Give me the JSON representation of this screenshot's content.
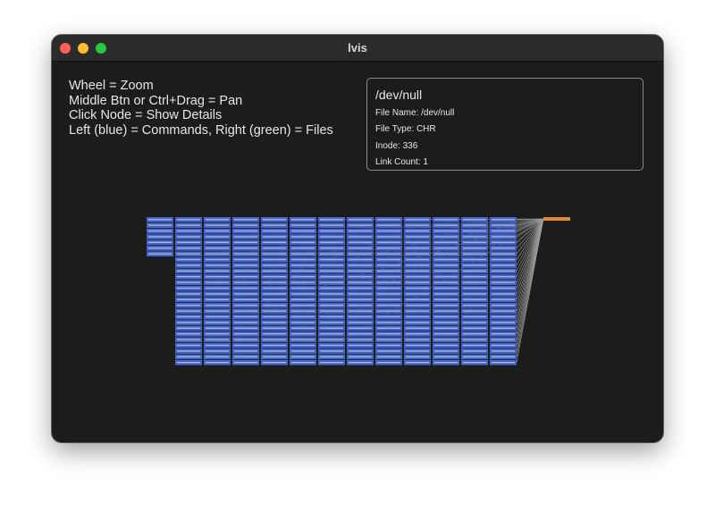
{
  "window": {
    "title": "lvis",
    "controls": [
      "close",
      "minimize",
      "maximize"
    ]
  },
  "help": {
    "lines": [
      "Wheel = Zoom",
      "Middle Btn or Ctrl+Drag = Pan",
      "Click Node = Show Details",
      "Left (blue) = Commands, Right (green) = Files"
    ]
  },
  "details": {
    "title": "/dev/null",
    "file_name": "File Name: /dev/null",
    "file_type": "File Type: CHR",
    "inode": "Inode: 336",
    "link_count": "Link Count: 1"
  },
  "graph": {
    "command_node_color": "#4566c8",
    "command_label_color": "#c8d4f2",
    "file_node_color": "#e08a2e",
    "edge_color": "#9a9a9a",
    "command_columns": 13,
    "column_node_counts": [
      7,
      26,
      26,
      26,
      26,
      26,
      26,
      26,
      26,
      26,
      26,
      26,
      26
    ],
    "file_nodes": 1
  }
}
